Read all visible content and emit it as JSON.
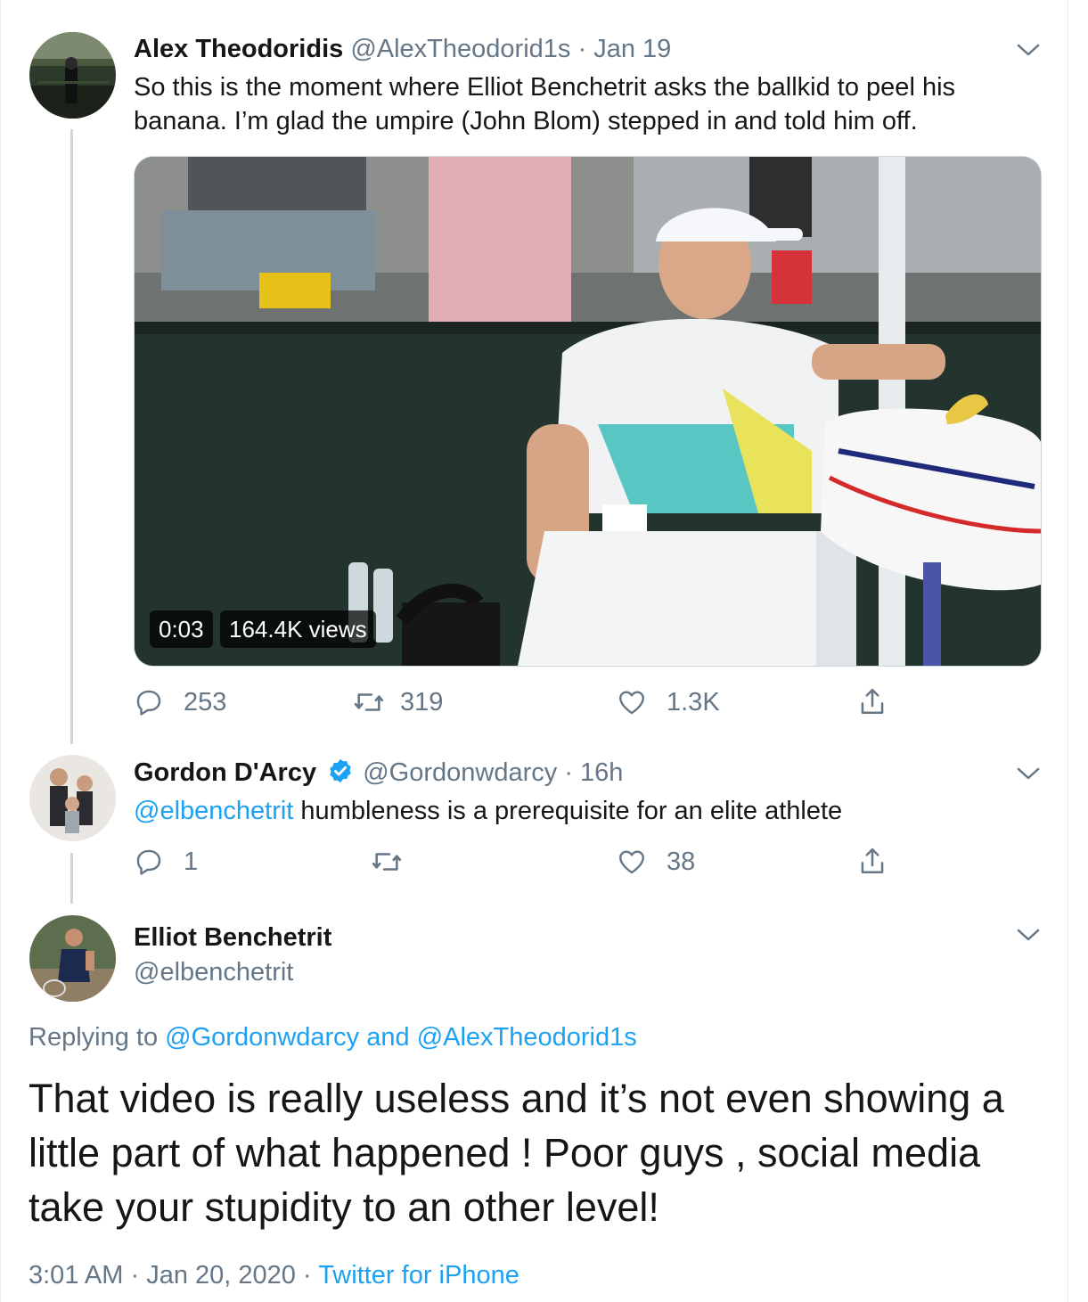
{
  "tweets": [
    {
      "name": "Alex Theodoridis",
      "handle": "@AlexTheodorid1s",
      "time": "Jan 19",
      "text": "So this is the moment where Elliot Benchetrit asks the ballkid to peel his banana. I’m glad the umpire (John Blom) stepped in and told him off.",
      "media": {
        "duration": "0:03",
        "views": "164.4K views"
      },
      "replies": "253",
      "retweets": "319",
      "likes": "1.3K"
    },
    {
      "name": "Gordon D'Arcy",
      "handle": "@Gordonwdarcy",
      "time": "16h",
      "mention": "@elbenchetrit",
      "text": " humbleness is a prerequisite for an elite athlete",
      "replies": "1",
      "retweets": "",
      "likes": "38"
    }
  ],
  "main_tweet": {
    "name": "Elliot Benchetrit",
    "handle": "@elbenchetrit",
    "replying_prefix": "Replying to ",
    "replying_user1": "@Gordonwdarcy",
    "replying_and": " and ",
    "replying_user2": "@AlexTheodorid1s",
    "text": "That video is really useless and it’s not even showing a little part of what happened ! Poor guys , social media take your stupidity to an other level!",
    "time": "3:01 AM",
    "date": "Jan 20, 2020",
    "source": "Twitter for iPhone"
  },
  "separator": "·",
  "colors": {
    "text": "#14171a",
    "secondary": "#657786",
    "link": "#1da1f2",
    "thread_line": "#ccd6dd"
  },
  "icons": [
    "reply-icon",
    "retweet-icon",
    "like-icon",
    "share-icon",
    "chevron-down-icon",
    "verified-badge-icon"
  ]
}
